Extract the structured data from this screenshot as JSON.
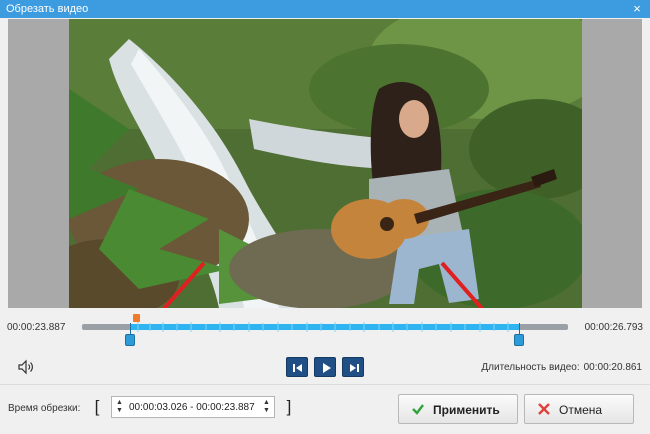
{
  "window": {
    "title": "Обрезать видео",
    "close_glyph": "×"
  },
  "timeline": {
    "start_time": "00:00:23.887",
    "end_time": "00:00:26.793"
  },
  "controls": {
    "duration_label": "Длительность видео:",
    "duration_value": "00:00:20.861"
  },
  "trim": {
    "label": "Время обрезки:",
    "bracket_left": "[",
    "bracket_right": "]",
    "value": "00:00:03.026 - 00:00:23.887"
  },
  "buttons": {
    "apply": "Применить",
    "cancel": "Отмена"
  },
  "colors": {
    "accent": "#3d9be0",
    "selection": "#2fb4f2",
    "handle": "#2d9bd8",
    "playhead": "#f07a2a",
    "arrow": "#e02020",
    "player_button": "#1f4f84"
  },
  "icons": {
    "volume": "speaker-icon",
    "prev": "skip-back-icon",
    "play": "play-icon",
    "next": "skip-forward-icon",
    "apply": "check-icon",
    "cancel": "x-icon"
  }
}
